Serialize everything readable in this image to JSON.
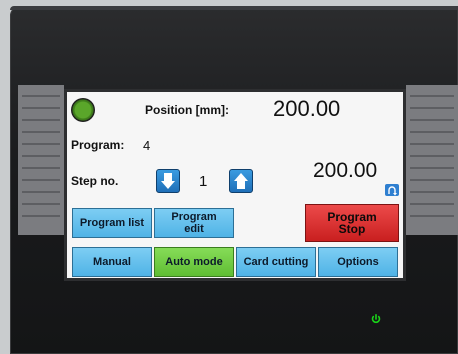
{
  "position": {
    "label": "Position  [mm]:",
    "value": "200.00"
  },
  "program": {
    "label": "Program:",
    "value": "4"
  },
  "step": {
    "label": "Step no.",
    "value": "1",
    "secondary_value": "200.00"
  },
  "buttons": {
    "program_list": "Program list",
    "program_edit": "Program\nedit",
    "program_stop": "Program\nStop",
    "manual": "Manual",
    "auto_mode": "Auto mode",
    "card_cutting": "Card cutting",
    "options": "Options"
  },
  "icons": {
    "status_led": "status-led-green",
    "step_down": "arrow-down-icon",
    "step_up": "arrow-up-icon",
    "step_reset": "reset-icon",
    "power": "power-icon"
  },
  "colors": {
    "button_blue": "#4fb3e6",
    "button_green": "#5fbd33",
    "button_red": "#c91f1f",
    "status_green": "#5aa62a",
    "power_led": "#19d319"
  }
}
